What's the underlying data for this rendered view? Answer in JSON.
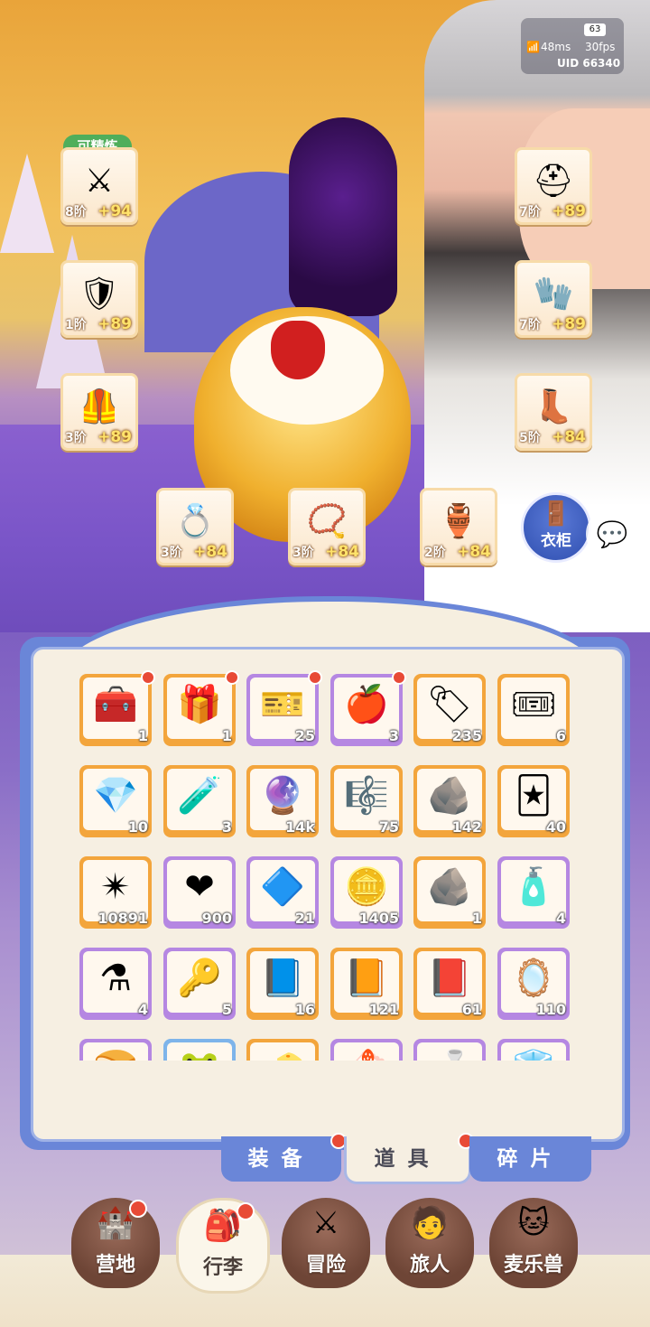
{
  "status": {
    "battery": "63",
    "ping": "48ms",
    "fps": "30fps",
    "uid": "UID 66340"
  },
  "equipment": {
    "refine_badge": "可精炼",
    "slots": [
      {
        "name": "weapon",
        "icon": "⚔",
        "tier": "8阶",
        "plus": "+94"
      },
      {
        "name": "chest",
        "icon": "🛡",
        "tier": "1阶",
        "plus": "+89"
      },
      {
        "name": "legs",
        "icon": "🦺",
        "tier": "3阶",
        "plus": "+89"
      },
      {
        "name": "helmet",
        "icon": "⛑",
        "tier": "7阶",
        "plus": "+89"
      },
      {
        "name": "gloves",
        "icon": "🧤",
        "tier": "7阶",
        "plus": "+89"
      },
      {
        "name": "boots",
        "icon": "👢",
        "tier": "5阶",
        "plus": "+84"
      },
      {
        "name": "ring",
        "icon": "💍",
        "tier": "3阶",
        "plus": "+84"
      },
      {
        "name": "necklace",
        "icon": "📿",
        "tier": "3阶",
        "plus": "+84"
      },
      {
        "name": "charm",
        "icon": "🏺",
        "tier": "2阶",
        "plus": "+84"
      }
    ]
  },
  "wardrobe": {
    "label": "衣柜",
    "icon": "🚪"
  },
  "chat": {
    "icon": "💬"
  },
  "inventory": {
    "items": [
      {
        "icon": "🧰",
        "count": "1",
        "rarity": "or",
        "dot": true
      },
      {
        "icon": "🎁",
        "count": "1",
        "rarity": "or",
        "dot": true
      },
      {
        "icon": "🎫",
        "count": "25",
        "rarity": "pu",
        "dot": true
      },
      {
        "icon": "🍎",
        "count": "3",
        "rarity": "pu",
        "dot": true
      },
      {
        "icon": "🏷",
        "count": "235",
        "rarity": "or",
        "dot": false
      },
      {
        "icon": "🎟",
        "count": "6",
        "rarity": "or",
        "dot": false
      },
      {
        "icon": "💎",
        "count": "10",
        "rarity": "or",
        "dot": false
      },
      {
        "icon": "🧪",
        "count": "3",
        "rarity": "or",
        "dot": false
      },
      {
        "icon": "🔮",
        "count": "14k",
        "rarity": "or",
        "dot": false
      },
      {
        "icon": "🎼",
        "count": "75",
        "rarity": "or",
        "dot": false
      },
      {
        "icon": "🪨",
        "count": "142",
        "rarity": "or",
        "dot": false
      },
      {
        "icon": "🃏",
        "count": "40",
        "rarity": "or",
        "dot": false
      },
      {
        "icon": "✴",
        "count": "10891",
        "rarity": "or",
        "dot": false
      },
      {
        "icon": "❤",
        "count": "900",
        "rarity": "pu",
        "dot": false
      },
      {
        "icon": "🔷",
        "count": "21",
        "rarity": "pu",
        "dot": false
      },
      {
        "icon": "🪙",
        "count": "1405",
        "rarity": "pu",
        "dot": false
      },
      {
        "icon": "🪨",
        "count": "1",
        "rarity": "or",
        "dot": false
      },
      {
        "icon": "🧴",
        "count": "4",
        "rarity": "pu",
        "dot": false
      },
      {
        "icon": "⚗",
        "count": "4",
        "rarity": "pu",
        "dot": false
      },
      {
        "icon": "🔑",
        "count": "5",
        "rarity": "pu",
        "dot": false
      },
      {
        "icon": "📘",
        "count": "16",
        "rarity": "or",
        "dot": false
      },
      {
        "icon": "📙",
        "count": "121",
        "rarity": "or",
        "dot": false
      },
      {
        "icon": "📕",
        "count": "61",
        "rarity": "or",
        "dot": false
      },
      {
        "icon": "🪞",
        "count": "110",
        "rarity": "pu",
        "dot": false
      },
      {
        "icon": "🍞",
        "count": "",
        "rarity": "pu",
        "dot": false
      },
      {
        "icon": "🐸",
        "count": "",
        "rarity": "bl",
        "dot": false
      },
      {
        "icon": "🧀",
        "count": "",
        "rarity": "or",
        "dot": false
      },
      {
        "icon": "🍰",
        "count": "",
        "rarity": "pu",
        "dot": false
      },
      {
        "icon": "🍶",
        "count": "",
        "rarity": "pu",
        "dot": false
      },
      {
        "icon": "🧊",
        "count": "",
        "rarity": "pu",
        "dot": false
      }
    ]
  },
  "tabs": [
    {
      "label": "装备",
      "active": false,
      "dot": true
    },
    {
      "label": "道具",
      "active": true,
      "dot": true
    },
    {
      "label": "碎片",
      "active": false,
      "dot": false
    }
  ],
  "nav": [
    {
      "label": "营地",
      "icon": "🏰",
      "active": false,
      "dot": true
    },
    {
      "label": "行李",
      "icon": "🎒",
      "active": true,
      "dot": true
    },
    {
      "label": "冒险",
      "icon": "⚔",
      "active": false,
      "dot": false
    },
    {
      "label": "旅人",
      "icon": "🧑",
      "active": false,
      "dot": false
    },
    {
      "label": "麦乐兽",
      "icon": "🐱",
      "active": false,
      "dot": false
    }
  ]
}
